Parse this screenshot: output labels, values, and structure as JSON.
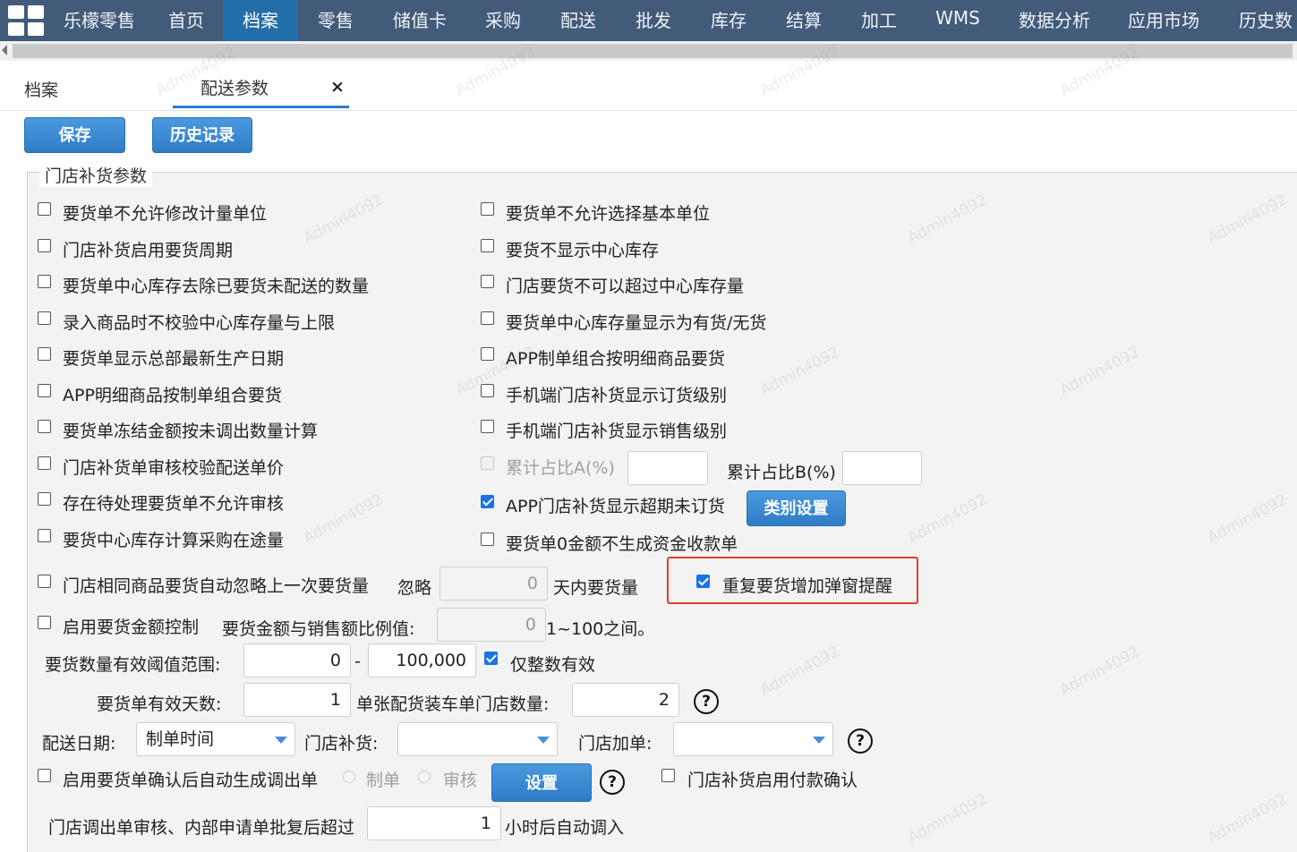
{
  "nav": {
    "items": [
      "乐檬零售",
      "首页",
      "档案",
      "零售",
      "储值卡",
      "采购",
      "配送",
      "批发",
      "库存",
      "结算",
      "加工",
      "WMS",
      "数据分析",
      "应用市场",
      "历史数"
    ],
    "active_index": 2
  },
  "tabs": {
    "archive": "档案",
    "delivery_params": "配送参数",
    "close_symbol": "×"
  },
  "toolbar": {
    "save": "保存",
    "history": "历史记录"
  },
  "section": {
    "legend": "门店补货参数"
  },
  "options": {
    "no_modify_unit": "要货单不允许修改计量单位",
    "no_select_base_unit": "要货单不允许选择基本单位",
    "enable_cycle": "门店补货启用要货周期",
    "hide_center_stock": "要货不显示中心库存",
    "exclude_undelivered": "要货单中心库存去除已要货未配送的数量",
    "no_exceed_center_stock": "门店要货不可以超过中心库存量",
    "no_check_limit": "录入商品时不校验中心库存量与上限",
    "show_in_stock": "要货单中心库存量显示为有货/无货",
    "show_hq_date": "要货单显示总部最新生产日期",
    "app_group_by_detail": "APP制单组合按明细商品要货",
    "app_detail_by_group": "APP明细商品按制单组合要货",
    "mobile_show_order_level": "手机端门店补货显示订货级别",
    "freeze_by_untransferred": "要货单冻结金额按未调出数量计算",
    "mobile_show_sales_level": "手机端门店补货显示销售级别",
    "verify_price": "门店补货单审核校验配送单价",
    "cum_ratio_a": "累计占比A(%)",
    "cum_ratio_b": "累计占比B(%)",
    "pending_no_audit": "存在待处理要货单不允许审核",
    "app_show_overdue": "APP门店补货显示超期未订货",
    "category_button": "类别设置",
    "calc_in_transit": "要货中心库存计算采购在途量",
    "zero_no_receipt": "要货单0金额不生成资金收款单",
    "auto_ignore_last": "门店相同商品要货自动忽略上一次要货量",
    "ignore": "忽略",
    "ignore_days": "0",
    "days_suffix": "天内要货量",
    "repeat_popup": "重复要货增加弹窗提醒",
    "enable_amount_ctrl": "启用要货金额控制",
    "ratio_label": "要货金额与销售额比例值:",
    "ratio_value": "0",
    "ratio_hint": "1~100之间。",
    "qty_range_label": "要货数量有效阈值范围:",
    "qty_min": "0",
    "range_dash": "-",
    "qty_max": "100,000",
    "integer_only": "仅整数有效",
    "valid_days_label": "要货单有效天数:",
    "valid_days": "1",
    "stores_per_truck_label": "单张配货装车单门店数量:",
    "stores_per_truck": "2",
    "help_symbol": "?",
    "delivery_date_label": "配送日期:",
    "delivery_date_value": "制单时间",
    "store_replenish_label": "门店补货:",
    "store_add_label": "门店加单:",
    "auto_transfer": "启用要货单确认后自动生成调出单",
    "radio_make": "制单",
    "radio_audit": "审核",
    "settings_button": "设置",
    "payment_confirm": "门店补货启用付款确认",
    "auto_in_label": "门店调出单审核、内部申请单批复后超过",
    "auto_in_hours": "1",
    "auto_in_suffix": "小时后自动调入"
  },
  "watermark": "Admin4092"
}
